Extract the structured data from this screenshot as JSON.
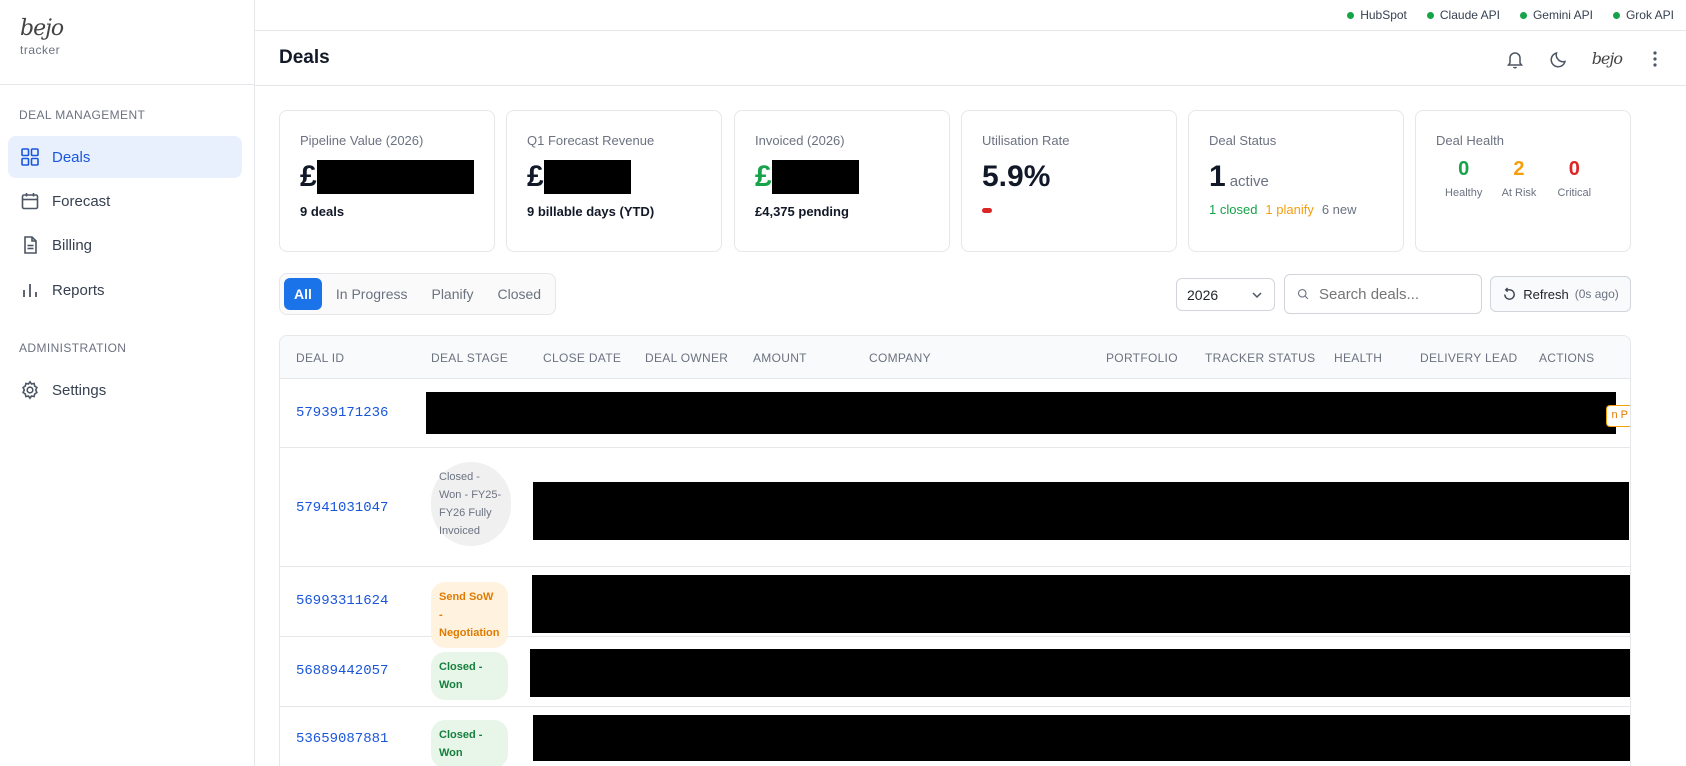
{
  "brand": {
    "logo": "bejo",
    "sub": "tracker"
  },
  "sidebar": {
    "sections": [
      {
        "title": "DEAL MANAGEMENT"
      },
      {
        "title": "ADMINISTRATION"
      }
    ],
    "items": [
      {
        "label": "Deals",
        "icon": "grid-icon",
        "active": true
      },
      {
        "label": "Forecast",
        "icon": "calendar-icon"
      },
      {
        "label": "Billing",
        "icon": "document-icon"
      },
      {
        "label": "Reports",
        "icon": "bar-chart-icon"
      },
      {
        "label": "Settings",
        "icon": "gear-icon"
      }
    ]
  },
  "statusbar": {
    "items": [
      {
        "label": "HubSpot",
        "color": "#16a34a"
      },
      {
        "label": "Claude API",
        "color": "#16a34a"
      },
      {
        "label": "Gemini API",
        "color": "#16a34a"
      },
      {
        "label": "Grok API",
        "color": "#16a34a"
      }
    ]
  },
  "header": {
    "title": "Deals",
    "avatar_logo": "bejo"
  },
  "cards": {
    "pipeline": {
      "label": "Pipeline Value (2026)",
      "currency": "£",
      "foot": "9 deals"
    },
    "forecast": {
      "label": "Q1 Forecast Revenue",
      "currency": "£",
      "foot": "9 billable days (YTD)"
    },
    "invoiced": {
      "label": "Invoiced (2026)",
      "currency": "£",
      "foot": "£4,375 pending"
    },
    "utilisation": {
      "label": "Utilisation Rate",
      "value": "5.9%",
      "level": 0.059
    },
    "status": {
      "label": "Deal Status",
      "count": "1",
      "count_label": "active",
      "closed": "1 closed",
      "planify": "1 planify",
      "new": "6 new"
    },
    "health": {
      "label": "Deal Health",
      "healthy": {
        "value": "0",
        "label": "Healthy",
        "color": "#16a34a"
      },
      "at_risk": {
        "value": "2",
        "label": "At Risk",
        "color": "#f59e0b"
      },
      "critical": {
        "value": "0",
        "label": "Critical",
        "color": "#dc2626"
      }
    }
  },
  "filters": {
    "tabs": [
      "All",
      "In Progress",
      "Planify",
      "Closed"
    ],
    "active": "All",
    "year": "2026",
    "search_placeholder": "Search deals...",
    "refresh_label": "Refresh",
    "refresh_age": "(0s ago)"
  },
  "table": {
    "headers": [
      "DEAL ID",
      "DEAL STAGE",
      "CLOSE DATE",
      "DEAL OWNER",
      "AMOUNT",
      "COMPANY",
      "PORTFOLIO",
      "TRACKER STATUS",
      "HEALTH",
      "DELIVERY LEAD",
      "ACTIONS"
    ],
    "rows": [
      {
        "id": "57939171236",
        "stage": "",
        "edge_badge": "n P"
      },
      {
        "id": "57941031047",
        "stage": "Closed - Won - FY25-FY26 Fully Invoiced",
        "stage_style": "grey"
      },
      {
        "id": "56993311624",
        "stage": "Send SoW - Negotiation",
        "stage_style": "orange"
      },
      {
        "id": "56889442057",
        "stage": "Closed - Won",
        "stage_style": "green"
      },
      {
        "id": "53659087881",
        "stage": "Closed - Won",
        "stage_style": "green"
      }
    ]
  }
}
